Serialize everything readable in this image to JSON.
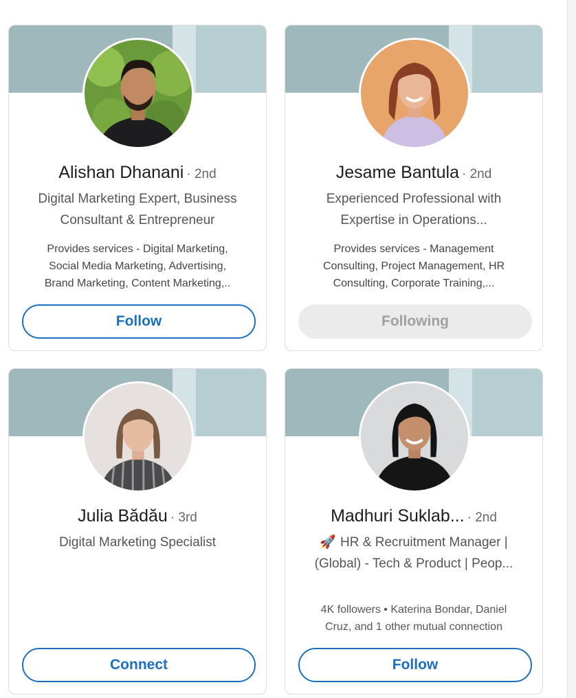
{
  "cards": [
    {
      "name": "Alishan Dhanani",
      "degree": "· 2nd",
      "headline_line1": "Digital Marketing Expert, Business",
      "headline_line2": "Consultant & Entrepreneur",
      "services_line1": "Provides services - Digital Marketing,",
      "services_line2": "Social Media Marketing, Advertising,",
      "services_line3": "Brand Marketing, Content Marketing,..",
      "button_label": "Follow",
      "avatar_icon": "person-photo"
    },
    {
      "name": "Jesame Bantula",
      "degree": "· 2nd",
      "headline_line1": "Experienced Professional with",
      "headline_line2": "Expertise in Operations...",
      "services_line1": "Provides services - Management",
      "services_line2": "Consulting, Project Management, HR",
      "services_line3": "Consulting, Corporate Training,...",
      "button_label": "Following",
      "avatar_icon": "person-photo"
    },
    {
      "name": "Julia Bădău",
      "degree": "· 3rd",
      "headline_line1": "Digital Marketing Specialist",
      "button_label": "Connect",
      "avatar_icon": "person-photo"
    },
    {
      "name": "Madhuri Suklab...",
      "degree": "· 2nd",
      "headline_emoji": "🚀",
      "headline_line1": "HR & Recruitment Manager |",
      "headline_line2": "(Global) - Tech & Product | Peop...",
      "mutual_line1": "4K followers • Katerina Bondar, Daniel",
      "mutual_line2": "Cruz, and 1 other mutual connection",
      "button_label": "Follow",
      "avatar_icon": "person-photo"
    }
  ],
  "colors": {
    "accent": "#1b6fc1",
    "banner": "#b6cdd2",
    "banner_dark": "#9fb8bc",
    "disabled_bg": "#ebebeb"
  }
}
